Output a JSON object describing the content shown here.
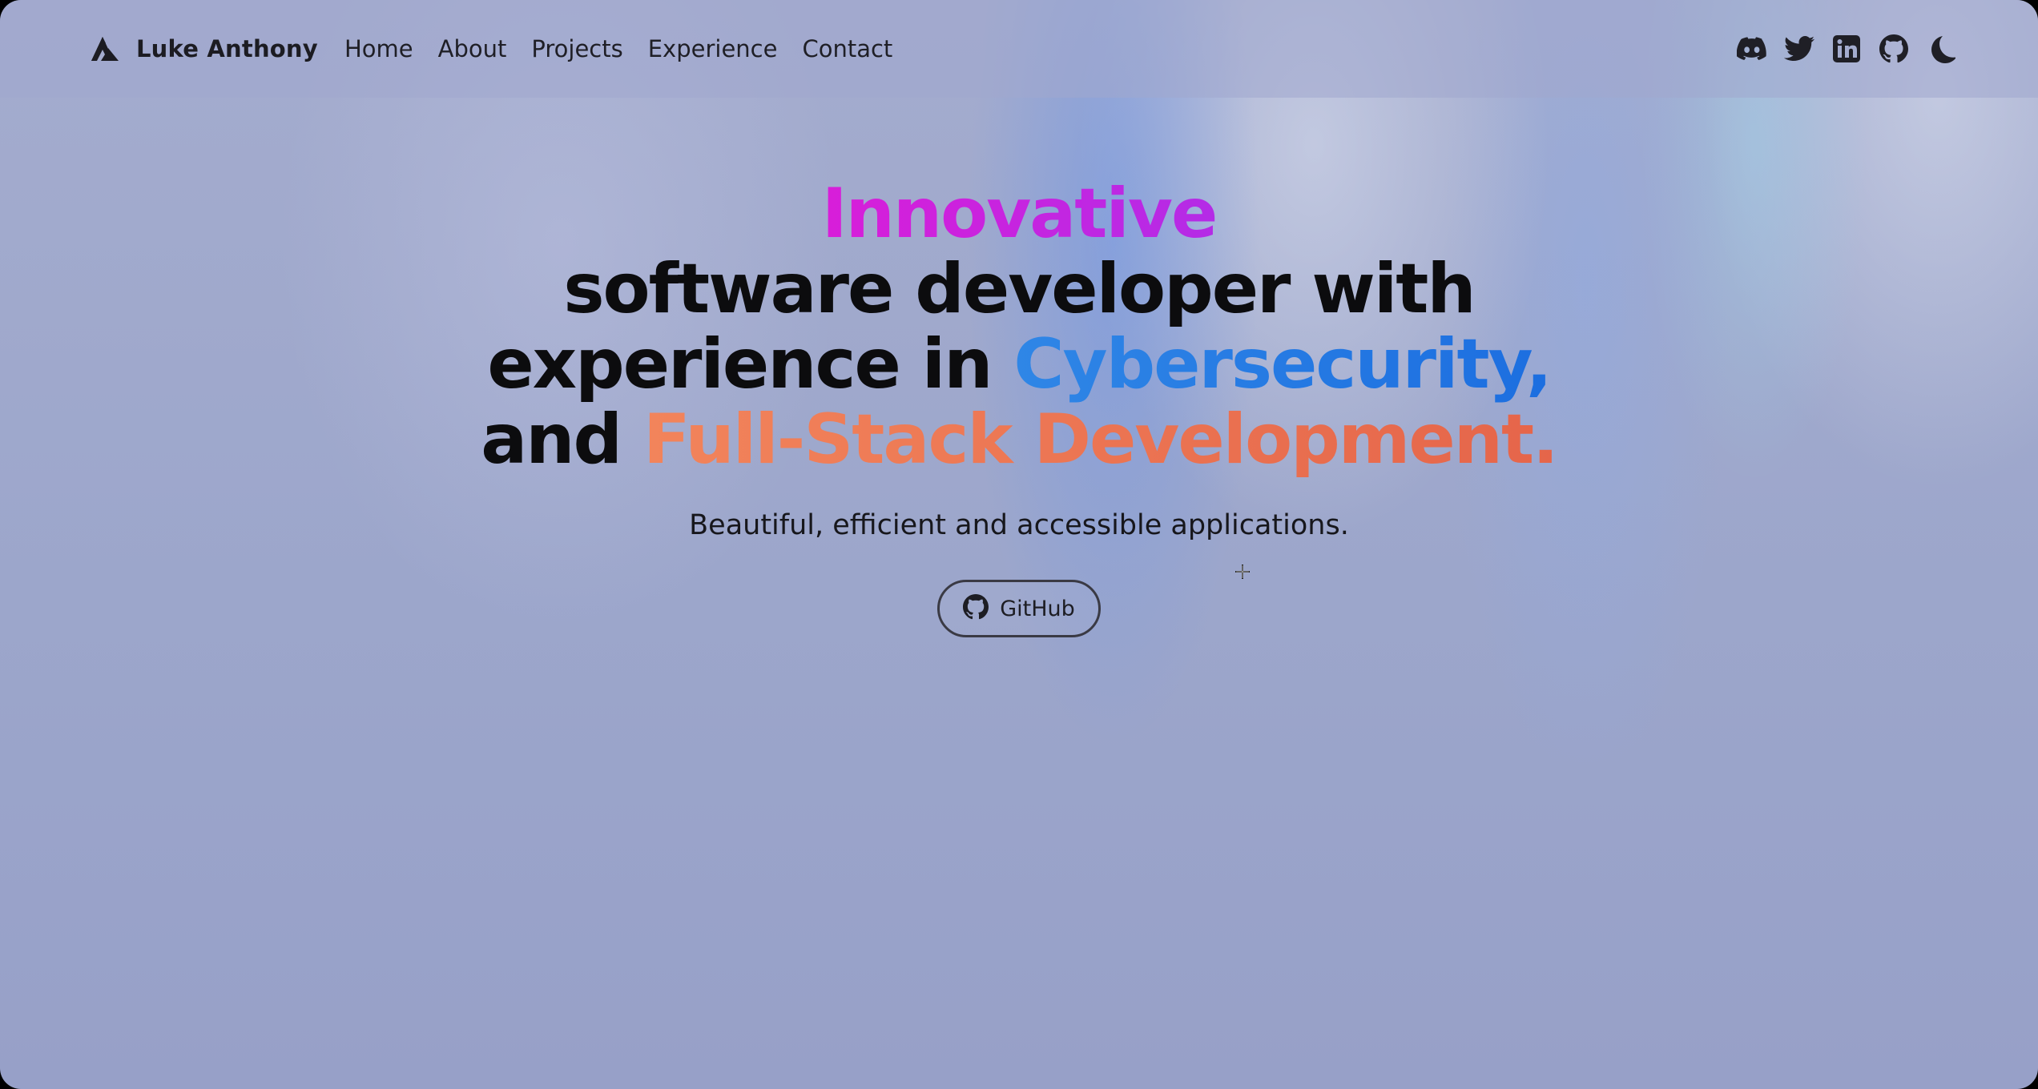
{
  "brand": {
    "name": "Luke Anthony",
    "logo_icon": "mountain-logo-icon"
  },
  "nav": {
    "links": [
      {
        "label": "Home"
      },
      {
        "label": "About"
      },
      {
        "label": "Projects"
      },
      {
        "label": "Experience"
      },
      {
        "label": "Contact"
      }
    ],
    "icons": [
      "discord-icon",
      "twitter-icon",
      "linkedin-icon",
      "github-icon",
      "moon-icon"
    ]
  },
  "hero": {
    "headline": {
      "line1_accent": "Innovative",
      "line2": "software developer with",
      "line3_prefix": "experience in ",
      "line3_accent": "Cybersecurity,",
      "line4_prefix": "and ",
      "line4_accent": "Full-Stack Development."
    },
    "subtitle": "Beautiful, efficient and accessible applications.",
    "cta": {
      "label": "GitHub",
      "icon": "github-icon"
    }
  },
  "colors": {
    "accent_purple": "#d81ed9",
    "accent_blue": "#2f86e6",
    "accent_orange": "#f2845b",
    "text_dark": "#0c0c0e",
    "background": "#9ca6cb"
  }
}
